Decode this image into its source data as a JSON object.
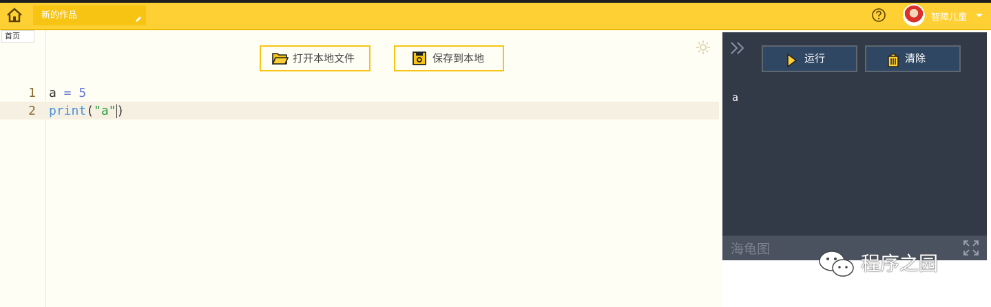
{
  "header": {
    "project_title": "新的作品",
    "username": "智障儿童"
  },
  "tabs": {
    "home_label": "首页"
  },
  "toolbar": {
    "open_file_label": "打开本地文件",
    "save_file_label": "保存到本地"
  },
  "editor": {
    "line_numbers": [
      "1",
      "2"
    ],
    "lines": [
      {
        "tokens": [
          "a",
          " = ",
          "5"
        ]
      },
      {
        "tokens": [
          "print",
          "(",
          "\"a\"",
          ")"
        ]
      }
    ]
  },
  "console": {
    "run_label": "运行",
    "clear_label": "清除",
    "output": "a"
  },
  "turtle": {
    "title": "海龟图"
  },
  "watermark": {
    "text": "程序之园"
  },
  "colors": {
    "header": "#fed033",
    "accent": "#f7c414",
    "panel": "#323a48",
    "button": "#2f4763"
  }
}
